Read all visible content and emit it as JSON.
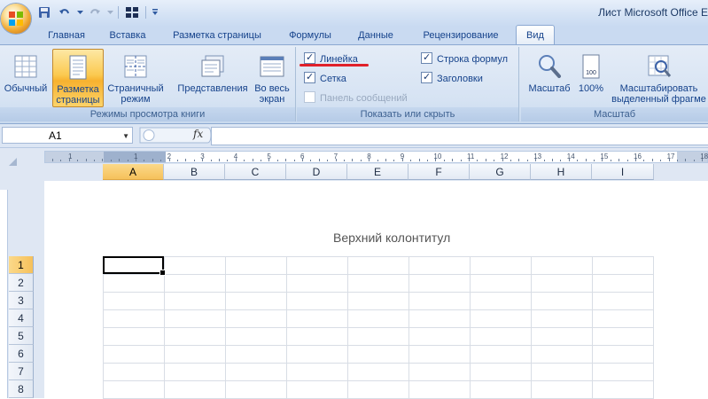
{
  "window": {
    "title": "Лист Microsoft Office E"
  },
  "tabs": [
    {
      "label": "Главная"
    },
    {
      "label": "Вставка"
    },
    {
      "label": "Разметка страницы"
    },
    {
      "label": "Формулы"
    },
    {
      "label": "Данные"
    },
    {
      "label": "Рецензирование"
    },
    {
      "label": "Вид",
      "active": true
    }
  ],
  "ribbon": {
    "views_group": {
      "label": "Режимы просмотра книги",
      "normal": "Обычный",
      "page_layout_1": "Разметка",
      "page_layout_2": "страницы",
      "page_break_1": "Страничный",
      "page_break_2": "режим",
      "custom_views": "Представления",
      "fullscreen_1": "Во весь",
      "fullscreen_2": "экран"
    },
    "show_group": {
      "label": "Показать или скрыть",
      "ruler": "Линейка",
      "gridlines": "Сетка",
      "message_bar": "Панель сообщений",
      "formula_bar": "Строка формул",
      "headings": "Заголовки"
    },
    "zoom_group": {
      "label": "Масштаб",
      "zoom": "Масштаб",
      "zoom100": "100%",
      "zoom_sel_1": "Масштабировать",
      "zoom_sel_2": "выделенный фрагме"
    }
  },
  "formula_bar": {
    "name_box": "A1",
    "fx": "fx",
    "value": ""
  },
  "ruler": [
    "1",
    "1",
    "2",
    "3",
    "4",
    "5",
    "6",
    "7",
    "8",
    "9",
    "10",
    "11",
    "12",
    "13",
    "14",
    "15",
    "16",
    "17",
    "18"
  ],
  "sheet": {
    "columns": [
      "A",
      "B",
      "C",
      "D",
      "E",
      "F",
      "G",
      "H",
      "I"
    ],
    "rows": [
      "1",
      "2",
      "3",
      "4",
      "5",
      "6",
      "7",
      "8"
    ],
    "header_text": "Верхний колонтитул",
    "active_cell": "A1"
  },
  "colors": {
    "accent_active": "#f7b12f",
    "ribbon_bg": "#d6e3f3",
    "underline_annotation": "#e0202a"
  }
}
